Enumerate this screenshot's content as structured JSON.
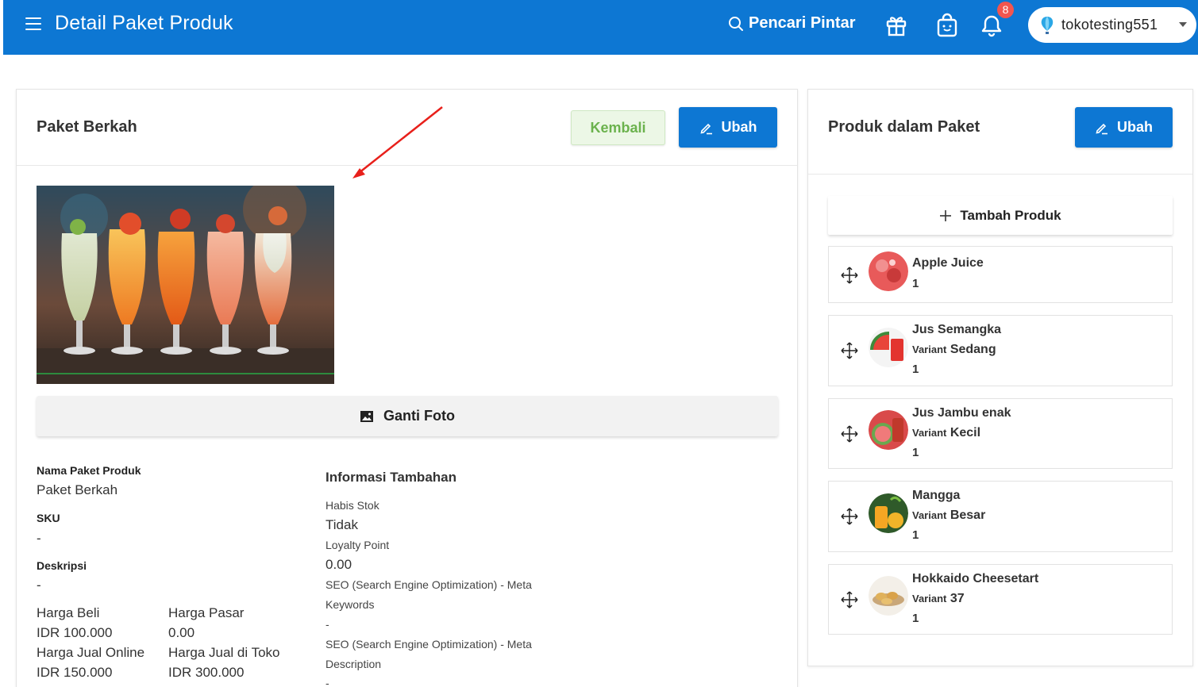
{
  "header": {
    "title": "Detail Paket Produk",
    "search_label": "Pencari Pintar",
    "notification_count": "8",
    "store_name": "tokotesting551",
    "background": "#0d77d3"
  },
  "bundle": {
    "card_title": "Paket Berkah",
    "back_label": "Kembali",
    "edit_label": "Ubah",
    "change_photo_label": "Ganti Foto",
    "fields": {
      "name_label": "Nama Paket Produk",
      "name_value": "Paket Berkah",
      "sku_label": "SKU",
      "sku_value": "-",
      "description_label": "Deskripsi",
      "description_value": "-",
      "buy_price_label": "Harga Beli",
      "buy_price_value": "IDR 100.000",
      "market_price_label": "Harga Pasar",
      "market_price_value": "0.00",
      "online_price_label": "Harga Jual Online",
      "online_price_value": "IDR 150.000",
      "store_price_label": "Harga Jual di Toko",
      "store_price_value": "IDR 300.000"
    },
    "additional": {
      "heading": "Informasi Tambahan",
      "out_of_stock_label": "Habis Stok",
      "out_of_stock_value": "Tidak",
      "loyalty_label": "Loyalty Point",
      "loyalty_value": "0.00",
      "seo_keywords_label_1": "SEO (Search Engine Optimization) - Meta",
      "seo_keywords_label_2": "Keywords",
      "seo_keywords_value": "-",
      "seo_description_label_1": "SEO (Search Engine Optimization) - Meta",
      "seo_description_label_2": "Description",
      "seo_description_value": "-"
    }
  },
  "products_panel": {
    "title": "Produk dalam Paket",
    "edit_label": "Ubah",
    "add_label": "Tambah Produk",
    "variant_key": "Variant",
    "items": [
      {
        "name": "Apple Juice",
        "variant": "",
        "qty": "1"
      },
      {
        "name": "Jus Semangka",
        "variant": "Sedang",
        "qty": "1"
      },
      {
        "name": "Jus Jambu enak",
        "variant": "Kecil",
        "qty": "1"
      },
      {
        "name": "Mangga",
        "variant": "Besar",
        "qty": "1"
      },
      {
        "name": "Hokkaido Cheesetart",
        "variant": "37",
        "qty": "1"
      }
    ]
  },
  "icons": {
    "menu": "menu-icon",
    "search": "search-icon",
    "gift": "gift-icon",
    "bag": "shopping-bag-icon",
    "bell": "bell-icon",
    "balloon": "balloon-icon",
    "edit": "pencil-icon",
    "image": "image-icon",
    "plus": "plus-icon",
    "move": "move-icon"
  },
  "colors": {
    "primary": "#0d77d3",
    "back_button_text": "#6bb24d",
    "badge": "#f2554f",
    "annotation_arrow": "#e8201b"
  }
}
